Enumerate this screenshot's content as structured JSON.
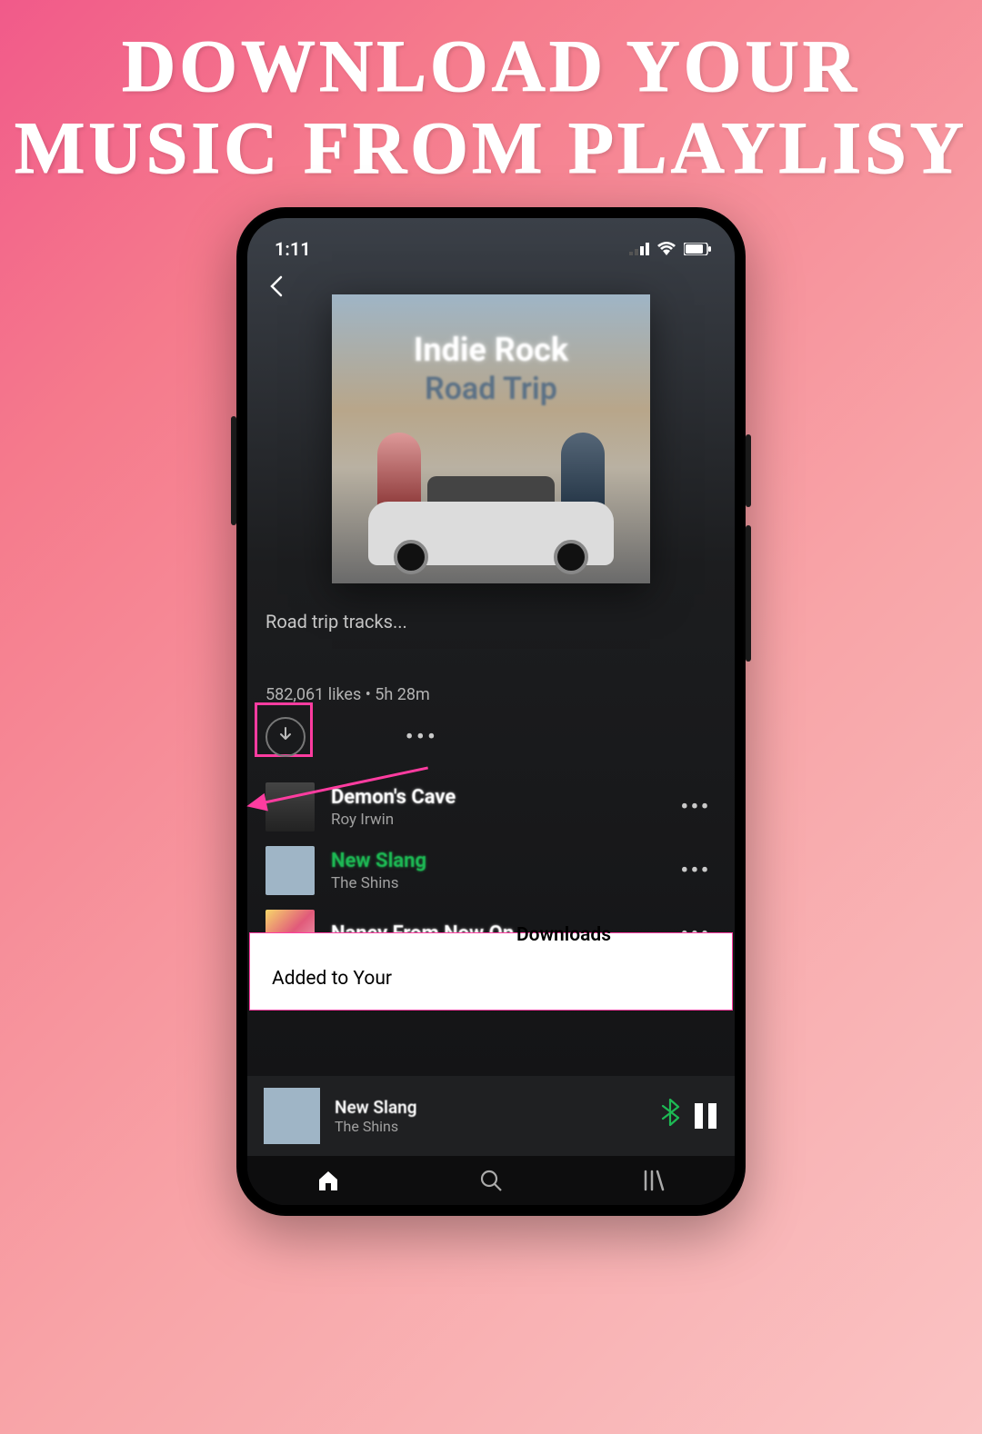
{
  "hero": {
    "line1": "DOWNLOAD YOUR",
    "line2": "MUSIC FROM PLAYLISY"
  },
  "statusbar": {
    "time": "1:11"
  },
  "cover": {
    "title1": "Indie Rock",
    "title2": "Road Trip"
  },
  "playlist": {
    "description": "Road trip tracks...",
    "meta": "582,061 likes • 5h 28m"
  },
  "tracks": [
    {
      "title": "Demon's Cave",
      "artist": "Roy Irwin",
      "playing": false,
      "thumb": "dark"
    },
    {
      "title": "New Slang",
      "artist": "The Shins",
      "playing": true,
      "thumb": "blue"
    },
    {
      "title": "Nancy From Now On",
      "artist": "",
      "playing": false,
      "thumb": "warm"
    }
  ],
  "toast": {
    "line_top": "Downloads",
    "line_left": "Added to Your"
  },
  "nowplaying": {
    "title": "New Slang",
    "artist": "The Shins"
  },
  "icons": {
    "more": "•••",
    "track_more": "•••"
  }
}
